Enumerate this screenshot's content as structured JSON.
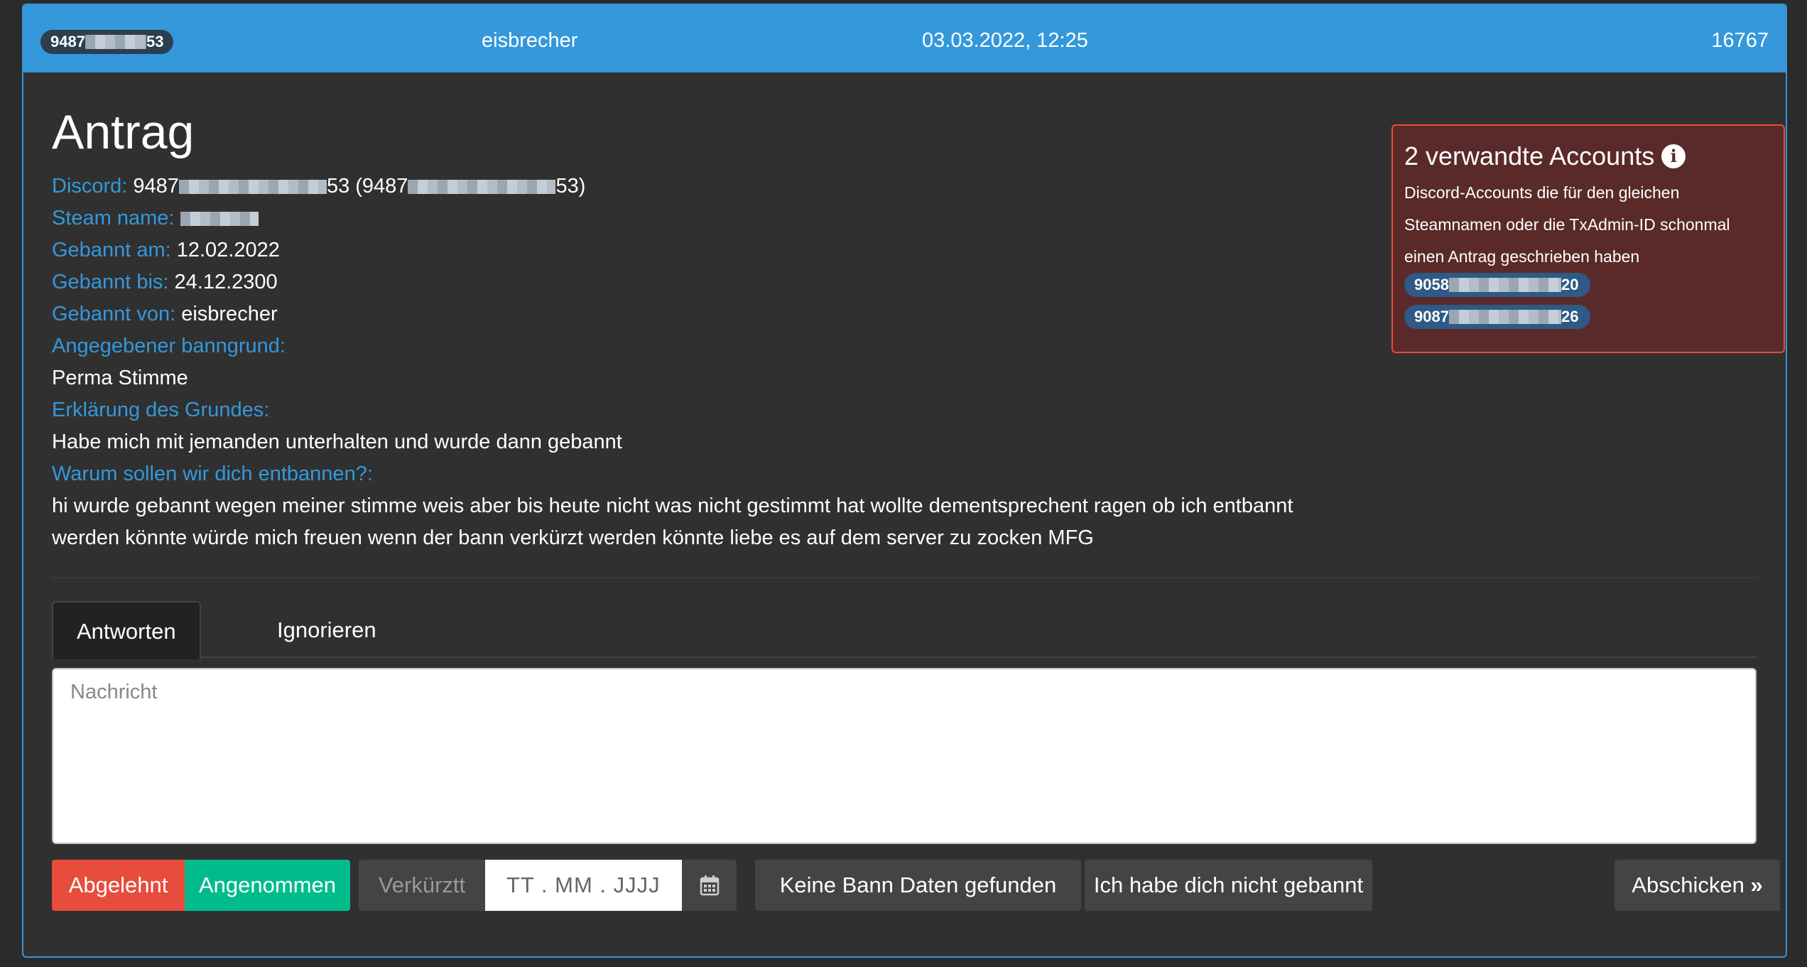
{
  "header": {
    "discord_badge_prefix": "9487",
    "discord_badge_suffix": "53",
    "admin": "eisbrecher",
    "datetime": "03.03.2022, 12:25",
    "id": "16767"
  },
  "request": {
    "title": "Antrag",
    "discord_label": "Discord:",
    "discord_prefix": "9487",
    "discord_suffix": "53 (9487",
    "discord_suffix2": "53)",
    "steam_label": "Steam name:",
    "banned_on_label": "Gebannt am:",
    "banned_on": "12.02.2022",
    "banned_until_label": "Gebannt bis:",
    "banned_until": "24.12.2300",
    "banned_by_label": "Gebannt von:",
    "banned_by": "eisbrecher",
    "reason_label": "Angegebener banngrund:",
    "reason": "Perma Stimme",
    "explanation_label": "Erklärung des Grundes:",
    "explanation": "Habe mich mit jemanden unterhalten und wurde dann gebannt",
    "why_label": "Warum sollen wir dich entbannen?:",
    "why": "hi wurde gebannt wegen meiner stimme weis aber bis heute nicht was nicht gestimmt hat wollte dementsprechent ragen ob ich entbannt werden könnte würde mich freuen wenn der bann verkürzt werden könnte liebe es auf dem server zu zocken MFG"
  },
  "related": {
    "title": "2 verwandte Accounts",
    "description": "Discord-Accounts die für den gleichen Steamnamen oder die TxAdmin-ID schonmal einen Antrag geschrieben haben",
    "accounts": [
      {
        "prefix": "9058",
        "suffix": "20"
      },
      {
        "prefix": "9087",
        "suffix": "26"
      }
    ]
  },
  "tabs": [
    "Antworten",
    "Ignorieren"
  ],
  "message": {
    "placeholder": "Nachricht"
  },
  "buttons": {
    "rejected": "Abgelehnt",
    "accepted": "Angenommen",
    "shortened": "Verkürztt",
    "date_placeholder": "TT . MM . JJJJ",
    "no_ban_data": "Keine Bann Daten gefunden",
    "not_banned_by_me": "Ich habe dich nicht gebannt",
    "send": "Abschicken"
  },
  "colors": {
    "accent": "#3498db",
    "danger": "#e74c3c",
    "success": "#00bc8c",
    "background": "#303030"
  }
}
